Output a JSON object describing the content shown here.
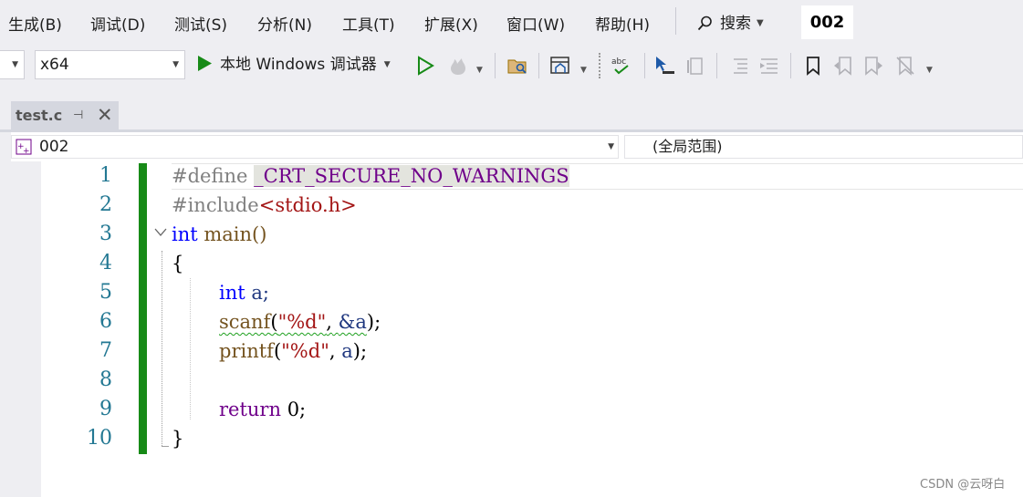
{
  "menu": {
    "items": [
      "生成(B)",
      "调试(D)",
      "测试(S)",
      "分析(N)",
      "工具(T)",
      "扩展(X)",
      "窗口(W)",
      "帮助(H)"
    ],
    "search_label": "搜索",
    "solution_name": "002"
  },
  "toolbar": {
    "platform": "x64",
    "run_label": "本地 Windows 调试器",
    "icons": [
      "run-without-debug-icon",
      "hot-reload-icon",
      "open-folder-icon",
      "window-layout-icon",
      "spell-check-icon",
      "select-pointer-icon",
      "format-icon",
      "indent-icon",
      "outdent-icon",
      "bookmark-icon",
      "prev-bookmark-icon",
      "next-bookmark-icon",
      "clear-bookmarks-icon"
    ]
  },
  "tab": {
    "title": "test.c"
  },
  "navbar": {
    "project": "002",
    "scope": "(全局范围)"
  },
  "editor": {
    "line_numbers": [
      "1",
      "2",
      "3",
      "4",
      "5",
      "6",
      "7",
      "8",
      "9",
      "10"
    ],
    "lines": {
      "l1_directive": "#define",
      "l1_macro": "_CRT_SECURE_NO_WARNINGS",
      "l2_directive": "#include",
      "l2_header": "<stdio.h>",
      "l3_kw": "int",
      "l3_rest": "main()",
      "l4": "{",
      "l5_kw": "int",
      "l5_rest": "a;",
      "l6_fn": "scanf",
      "l6_open": "(",
      "l6_str": "\"%d\"",
      "l6_comma": ",",
      "l6_arg": "&a",
      "l6_close": ");",
      "l7_fn": "printf",
      "l7_open": "(",
      "l7_str": "\"%d\"",
      "l7_comma": ",",
      "l7_arg": "a",
      "l7_close": ");",
      "l9_kw": "return",
      "l9_rest": "0;",
      "l10": "}"
    }
  },
  "watermark": "CSDN @云呀白",
  "colors": {
    "keyword": "#0000ff",
    "macro": "#6f008a",
    "string": "#a31515",
    "change_bar": "#178a17"
  }
}
